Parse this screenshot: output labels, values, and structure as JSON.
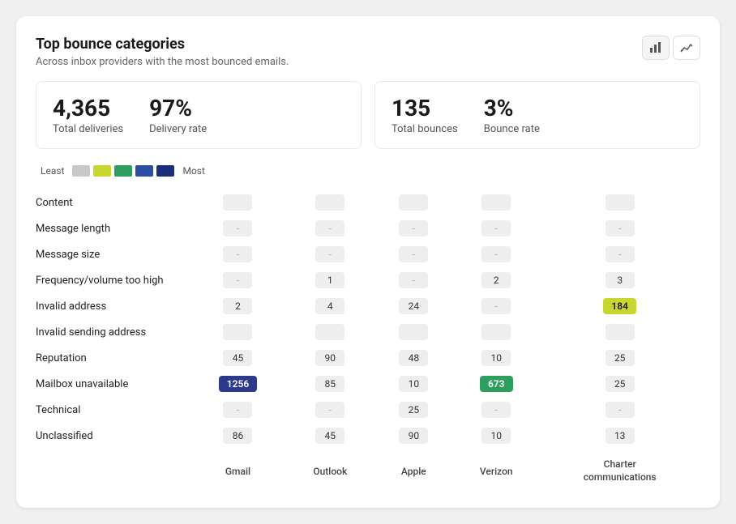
{
  "header": {
    "title": "Top bounce categories",
    "subtitle": "Across inbox providers with the most bounced emails.",
    "bar_chart_icon": "bar-chart-icon",
    "line_chart_icon": "line-chart-icon"
  },
  "stats": {
    "left": {
      "total_deliveries_value": "4,365",
      "total_deliveries_label": "Total deliveries",
      "delivery_rate_value": "97%",
      "delivery_rate_label": "Delivery rate"
    },
    "right": {
      "total_bounces_value": "135",
      "total_bounces_label": "Total bounces",
      "bounce_rate_value": "3%",
      "bounce_rate_label": "Bounce rate"
    }
  },
  "legend": {
    "least_label": "Least",
    "most_label": "Most"
  },
  "table": {
    "columns": [
      "Gmail",
      "Outlook",
      "Apple",
      "Verizon",
      "Charter\ncommunications"
    ],
    "rows": [
      {
        "label": "Content",
        "values": [
          "",
          "",
          "",
          "",
          ""
        ]
      },
      {
        "label": "Message length",
        "values": [
          "-",
          "-",
          "-",
          "-",
          "-"
        ]
      },
      {
        "label": "Message size",
        "values": [
          "-",
          "-",
          "-",
          "-",
          "-"
        ]
      },
      {
        "label": "Frequency/volume too high",
        "values": [
          "-",
          "1",
          "-",
          "2",
          "3"
        ]
      },
      {
        "label": "Invalid address",
        "values": [
          "2",
          "4",
          "24",
          "-",
          "184"
        ]
      },
      {
        "label": "Invalid sending address",
        "values": [
          "",
          "",
          "",
          "",
          ""
        ]
      },
      {
        "label": "Reputation",
        "values": [
          "45",
          "90",
          "48",
          "10",
          "25"
        ]
      },
      {
        "label": "Mailbox unavailable",
        "values": [
          "1256",
          "85",
          "10",
          "673",
          "25"
        ]
      },
      {
        "label": "Technical",
        "values": [
          "-",
          "-",
          "25",
          "-",
          "-"
        ]
      },
      {
        "label": "Unclassified",
        "values": [
          "86",
          "45",
          "90",
          "10",
          "13"
        ]
      }
    ]
  },
  "highlights": {
    "invalid_address_charter": "yellow",
    "mailbox_gmail": "dark-blue",
    "mailbox_verizon": "green"
  }
}
